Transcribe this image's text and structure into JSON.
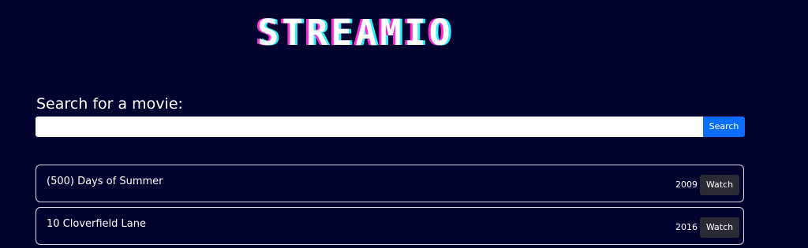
{
  "app": {
    "logo_text": "STREAMIO"
  },
  "search": {
    "label": "Search for a movie:",
    "value": "",
    "placeholder": "",
    "button_label": "Search"
  },
  "movies": [
    {
      "title": "(500) Days of Summer",
      "year": "2009",
      "action_label": "Watch"
    },
    {
      "title": "10 Cloverfield Lane",
      "year": "2016",
      "action_label": "Watch"
    }
  ],
  "colors": {
    "background": "#02022e",
    "accent": "#0d6efd",
    "logo_shadow_left": "#ff2bd6",
    "logo_shadow_right": "#2af0ff",
    "watch_button": "#2b2b36"
  }
}
